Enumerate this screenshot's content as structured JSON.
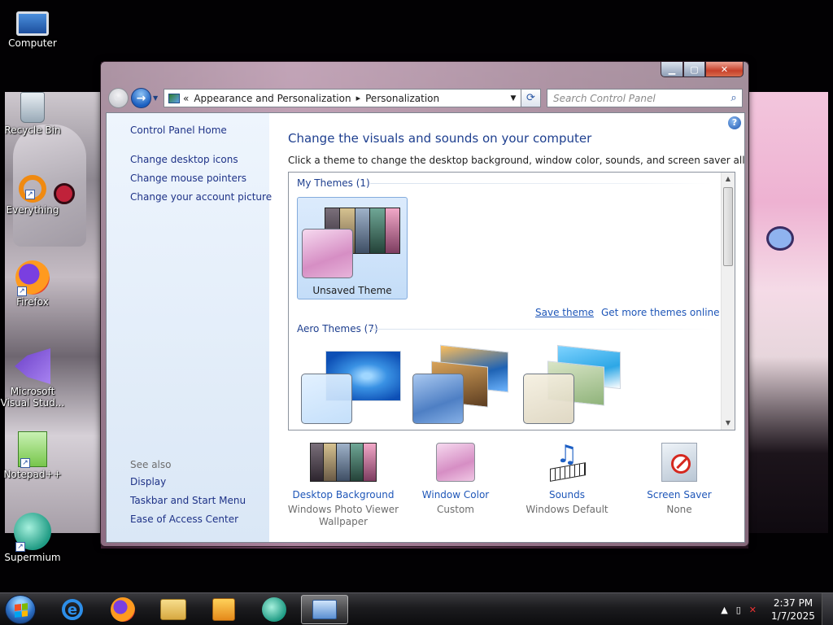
{
  "desktop": {
    "icons": [
      {
        "label": "Computer"
      },
      {
        "label": "Recycle Bin"
      },
      {
        "label": "Everything"
      },
      {
        "label": "Firefox"
      },
      {
        "label": "Microsoft Visual Stud..."
      },
      {
        "label": "Notepad++"
      },
      {
        "label": "Supermium"
      }
    ]
  },
  "window": {
    "controls": {
      "minimize": "▁",
      "maximize": "▢",
      "close": "✕"
    },
    "nav": {
      "back": "←",
      "forward": "→",
      "dropdown": "▼"
    },
    "address": {
      "overflow": "«",
      "crumbs": [
        "Appearance and Personalization",
        "Personalization"
      ],
      "separator": "▸",
      "dropdown": "▼",
      "refresh": "⟳"
    },
    "search": {
      "placeholder": "Search Control Panel",
      "icon": "⌕"
    },
    "left_pane": {
      "home": "Control Panel Home",
      "links": [
        "Change desktop icons",
        "Change mouse pointers",
        "Change your account picture"
      ],
      "see_also_title": "See also",
      "see_also": [
        "Display",
        "Taskbar and Start Menu",
        "Ease of Access Center"
      ]
    },
    "main": {
      "help": "?",
      "title": "Change the visuals and sounds on your computer",
      "description": "Click a theme to change the desktop background, window color, sounds, and screen saver all at once.",
      "my_themes_header": "My Themes (1)",
      "my_themes": [
        {
          "name": "Unsaved Theme"
        }
      ],
      "save_theme": "Save theme",
      "get_more": "Get more themes online",
      "aero_header": "Aero Themes (7)"
    },
    "bottom": [
      {
        "label": "Desktop Background",
        "sub": "Windows Photo Viewer Wallpaper"
      },
      {
        "label": "Window Color",
        "sub": "Custom"
      },
      {
        "label": "Sounds",
        "sub": "Windows Default"
      },
      {
        "label": "Screen Saver",
        "sub": "None"
      }
    ]
  },
  "taskbar": {
    "tray": {
      "show_hidden": "▲",
      "time": "2:37 PM",
      "date": "1/7/2025"
    },
    "items": [
      "Internet Explorer",
      "Firefox",
      "Windows Explorer",
      "Media Player",
      "Supermium",
      "Personalization"
    ]
  },
  "colors": {
    "link": "#1e56b8",
    "title": "#1e3f8f",
    "left_pane_link": "#1e3287",
    "selection": "#c4ddf8"
  }
}
